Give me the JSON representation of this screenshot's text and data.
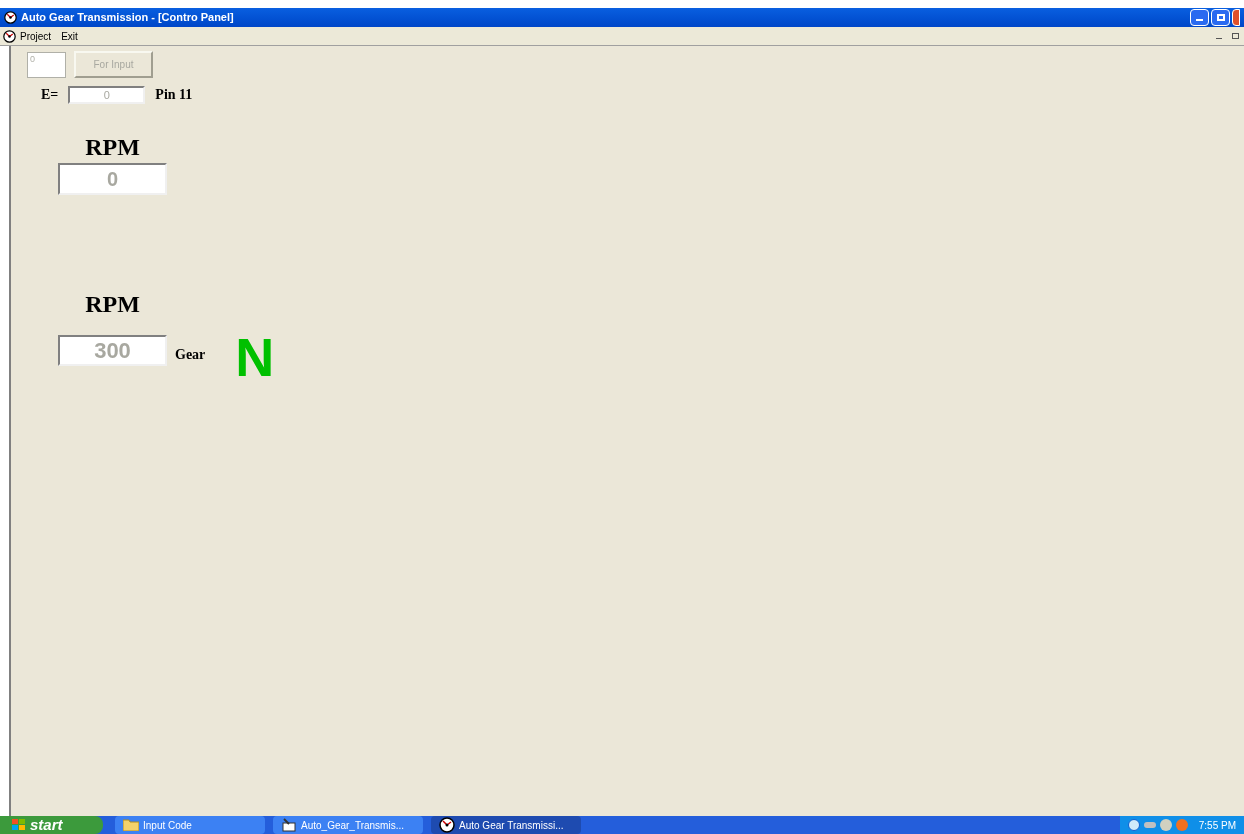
{
  "window": {
    "title": "Auto Gear Transmission - [Contro Panel]"
  },
  "menu": [
    "Project",
    "Exit"
  ],
  "input_row": {
    "field_value": "0",
    "button": "For Input",
    "disabled": true
  },
  "e_row": {
    "label": "E=",
    "value": "0",
    "pin": "Pin 11"
  },
  "rpm_top": {
    "label": "RPM",
    "value": "0"
  },
  "rpm_bottom": {
    "label": "RPM",
    "value": "300",
    "gear_label": "Gear",
    "gear": "N",
    "color": "#00c000"
  },
  "taskbar": {
    "start": "start",
    "items": [
      {
        "label": "Input Code",
        "kind": "folder",
        "selected": false
      },
      {
        "label": "Auto_Gear_Transmis...",
        "kind": "tool",
        "selected": false
      },
      {
        "label": "Auto Gear Transmissi...",
        "kind": "app",
        "selected": true
      }
    ],
    "clock": "7:55 PM"
  }
}
